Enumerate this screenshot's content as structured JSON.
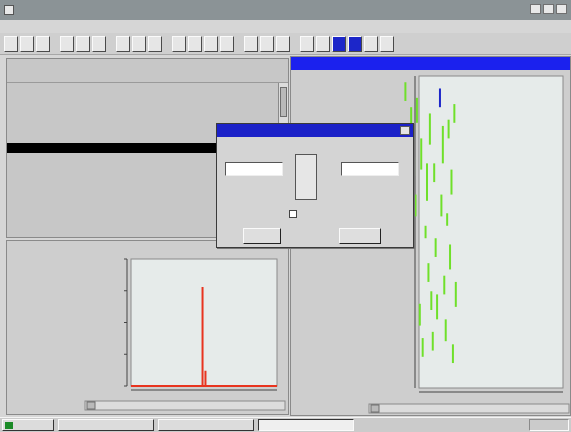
{
  "window": {
    "title": ""
  },
  "menu": {
    "items": [
      "",
      "",
      "",
      "",
      "",
      "",
      "",
      "",
      ""
    ]
  },
  "toolbar": {
    "button_count": 22
  },
  "table": {
    "headers": [
      "",
      "",
      "",
      "",
      "",
      ""
    ],
    "rows": [
      [
        "",
        "",
        "",
        "",
        "",
        ""
      ],
      [
        "",
        "",
        "",
        "",
        "",
        ""
      ],
      [
        "",
        "",
        "",
        "",
        "",
        ""
      ],
      [
        "",
        "",
        "",
        "",
        "",
        ""
      ],
      [
        "",
        "",
        "",
        "",
        "",
        ""
      ],
      [
        "",
        "",
        "",
        "",
        "",
        ""
      ],
      [
        "",
        "",
        "",
        "",
        "",
        ""
      ],
      [
        "",
        "",
        "",
        "",
        "",
        ""
      ],
      [
        "",
        "",
        "",
        "",
        "",
        ""
      ],
      [
        "",
        "",
        "",
        "",
        "",
        ""
      ],
      [
        "",
        "",
        "",
        "",
        "",
        ""
      ],
      [
        "",
        "",
        "",
        "",
        "",
        ""
      ],
      [
        "",
        "",
        "",
        "",
        "",
        ""
      ],
      [
        "",
        "",
        "",
        "",
        "",
        ""
      ],
      [
        "",
        "",
        "",
        "",
        "",
        ""
      ]
    ],
    "selected_row": 6
  },
  "plot_window": {
    "title": ""
  },
  "dialog": {
    "title": "",
    "left_label": "",
    "left_value": "",
    "right_label": "",
    "right_value": "",
    "checkbox_label": "",
    "checkbox_checked": false,
    "ok_label": "",
    "cancel_label": ""
  },
  "taskbar": {
    "start_label": "",
    "tasks": [
      "",
      "",
      ""
    ],
    "active_task": 2,
    "clock": ""
  },
  "colors": {
    "titlebar_inactive": "#8b9396",
    "active_title": "#1b21ee",
    "spectrum_line": "#e8341f",
    "peak_marks": "#6fe02a",
    "peak_marks_alt": "#1c26c9"
  },
  "chart_data": [
    {
      "type": "line",
      "title": "",
      "xlabel": "",
      "ylabel": "",
      "xlim": [
        0,
        100
      ],
      "ylim": [
        0,
        100
      ],
      "grid": false,
      "series": [
        {
          "x": [
            0,
            49,
            49,
            49,
            51,
            51,
            51,
            100
          ],
          "y": [
            0,
            0,
            78,
            0,
            0,
            12,
            0,
            0
          ]
        }
      ]
    },
    {
      "type": "scatter",
      "title": "",
      "xlabel": "",
      "ylabel": "",
      "xlim": [
        0,
        100
      ],
      "ylim": [
        0,
        100
      ],
      "grid": false,
      "series": [
        {
          "segments": [
            [
              60,
              92,
              98
            ],
            [
              62,
              75,
              80
            ],
            [
              64,
              82,
              90
            ],
            [
              66,
              68,
              74
            ],
            [
              67,
              55,
              62
            ],
            [
              68,
              85,
              93
            ],
            [
              70,
              20,
              27
            ],
            [
              71,
              70,
              80
            ],
            [
              72,
              10,
              16
            ],
            [
              74,
              48,
              52
            ],
            [
              75,
              60,
              72
            ],
            [
              76,
              34,
              40
            ],
            [
              77,
              78,
              88
            ],
            [
              78,
              25,
              31
            ],
            [
              79,
              12,
              18
            ],
            [
              80,
              66,
              72
            ],
            [
              81,
              42,
              48
            ],
            [
              82,
              22,
              30
            ],
            [
              84,
              90,
              96
            ],
            [
              85,
              55,
              62
            ],
            [
              86,
              72,
              84
            ],
            [
              87,
              30,
              36
            ],
            [
              88,
              15,
              22
            ],
            [
              89,
              52,
              56
            ],
            [
              90,
              80,
              86
            ],
            [
              91,
              38,
              46
            ],
            [
              92,
              62,
              70
            ],
            [
              93,
              8,
              14
            ],
            [
              94,
              85,
              91
            ],
            [
              95,
              26,
              34
            ]
          ]
        }
      ]
    }
  ]
}
